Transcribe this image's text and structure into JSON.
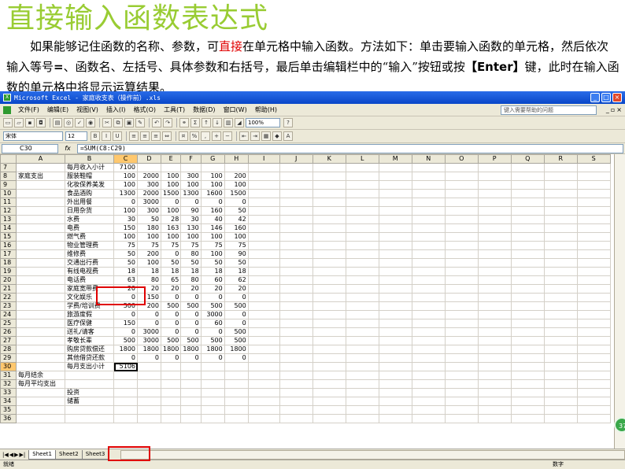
{
  "slide": {
    "title": "直接输入函数表达式",
    "intro_part1": "如果能够记住函数的名称、参数，可",
    "intro_highlight": "直接",
    "intro_part2": "在单元格中输入函数。方法如下：单击要输入函数的单元格，然后依次输入等号",
    "intro_equals": "=",
    "intro_part3": "、函数名、左括号、具体参数和右括号，最后单击编辑栏中的“输入”按钮或按",
    "intro_key": "【Enter】",
    "intro_part4": "键，此时在输入函数的单元格中将显示运算结果。",
    "page_badge": "37"
  },
  "excel": {
    "window_title": "Microsoft Excel - 家庭收支表（操作前）.xls",
    "menu": [
      "文件(F)",
      "编辑(E)",
      "视图(V)",
      "插入(I)",
      "格式(O)",
      "工具(T)",
      "数据(D)",
      "窗口(W)",
      "帮助(H)"
    ],
    "help_placeholder": "键入需要帮助的问题",
    "zoom": "100%",
    "font_name": "宋体",
    "font_size": "12",
    "name_box": "C30",
    "fx_label": "fx",
    "formula": "=SUM(C8:C29)",
    "columns": [
      "A",
      "B",
      "C",
      "D",
      "E",
      "F",
      "G",
      "H",
      "I",
      "J",
      "K",
      "L",
      "M",
      "N",
      "O",
      "P",
      "Q",
      "R",
      "S"
    ],
    "rows": [
      {
        "n": "7",
        "a": "",
        "b": "每月收入小计",
        "v": [
          "7100",
          "",
          "",
          "",
          "",
          ""
        ]
      },
      {
        "n": "8",
        "a": "家庭支出",
        "b": "服装鞋帽",
        "v": [
          "100",
          "2000",
          "100",
          "300",
          "100",
          "200"
        ]
      },
      {
        "n": "9",
        "a": "",
        "b": "化妆保养美发",
        "v": [
          "100",
          "300",
          "100",
          "100",
          "100",
          "100"
        ]
      },
      {
        "n": "10",
        "a": "",
        "b": "食品酒购",
        "v": [
          "1300",
          "2000",
          "1500",
          "1300",
          "1600",
          "1500"
        ]
      },
      {
        "n": "11",
        "a": "",
        "b": "外出用餐",
        "v": [
          "0",
          "3000",
          "0",
          "0",
          "0",
          "0"
        ]
      },
      {
        "n": "12",
        "a": "",
        "b": "日用杂货",
        "v": [
          "100",
          "300",
          "100",
          "90",
          "160",
          "50"
        ]
      },
      {
        "n": "13",
        "a": "",
        "b": "水费",
        "v": [
          "30",
          "50",
          "28",
          "30",
          "40",
          "42"
        ]
      },
      {
        "n": "14",
        "a": "",
        "b": "电费",
        "v": [
          "150",
          "180",
          "163",
          "130",
          "146",
          "160"
        ]
      },
      {
        "n": "15",
        "a": "",
        "b": "燃气费",
        "v": [
          "100",
          "100",
          "100",
          "100",
          "100",
          "100"
        ]
      },
      {
        "n": "16",
        "a": "",
        "b": "物业管理费",
        "v": [
          "75",
          "75",
          "75",
          "75",
          "75",
          "75"
        ]
      },
      {
        "n": "17",
        "a": "",
        "b": "维修费",
        "v": [
          "50",
          "200",
          "0",
          "80",
          "100",
          "90"
        ]
      },
      {
        "n": "18",
        "a": "",
        "b": "交通出行费",
        "v": [
          "50",
          "100",
          "50",
          "50",
          "50",
          "50"
        ]
      },
      {
        "n": "19",
        "a": "",
        "b": "有线电视费",
        "v": [
          "18",
          "18",
          "18",
          "18",
          "18",
          "18"
        ]
      },
      {
        "n": "20",
        "a": "",
        "b": "电话费",
        "v": [
          "63",
          "80",
          "65",
          "80",
          "60",
          "62"
        ]
      },
      {
        "n": "21",
        "a": "",
        "b": "家庭宽带费",
        "v": [
          "20",
          "20",
          "20",
          "20",
          "20",
          "20"
        ]
      },
      {
        "n": "22",
        "a": "",
        "b": "文化娱乐",
        "v": [
          "0",
          "150",
          "0",
          "0",
          "0",
          "0"
        ]
      },
      {
        "n": "23",
        "a": "",
        "b": "学费/培训费",
        "v": [
          "500",
          "200",
          "500",
          "500",
          "500",
          "500"
        ]
      },
      {
        "n": "24",
        "a": "",
        "b": "旅游度假",
        "v": [
          "0",
          "0",
          "0",
          "0",
          "3000",
          "0"
        ]
      },
      {
        "n": "25",
        "a": "",
        "b": "医疗保健",
        "v": [
          "150",
          "0",
          "0",
          "0",
          "60",
          "0"
        ]
      },
      {
        "n": "26",
        "a": "",
        "b": "送礼/请客",
        "v": [
          "0",
          "3000",
          "0",
          "0",
          "0",
          "500"
        ]
      },
      {
        "n": "27",
        "a": "",
        "b": "孝敬长辈",
        "v": [
          "500",
          "3000",
          "500",
          "500",
          "500",
          "500"
        ]
      },
      {
        "n": "28",
        "a": "",
        "b": "购房贷款偿还",
        "v": [
          "1800",
          "1800",
          "1800",
          "1800",
          "1800",
          "1800"
        ]
      },
      {
        "n": "29",
        "a": "",
        "b": "其他借贷还款",
        "v": [
          "0",
          "0",
          "0",
          "0",
          "0",
          "0"
        ]
      },
      {
        "n": "30",
        "a": "",
        "b": "每月支出小计",
        "v": [
          "5106",
          "",
          "",
          "",
          "",
          ""
        ]
      },
      {
        "n": "31",
        "a": "每月结余",
        "b": "",
        "v": [
          "",
          "",
          "",
          "",
          "",
          ""
        ]
      },
      {
        "n": "32",
        "a": "每月平均支出",
        "b": "",
        "v": [
          "",
          "",
          "",
          "",
          "",
          ""
        ]
      },
      {
        "n": "33",
        "a": "",
        "b": "投资",
        "v": [
          "",
          "",
          "",
          "",
          "",
          ""
        ]
      },
      {
        "n": "34",
        "a": "",
        "b": "储蓄",
        "v": [
          "",
          "",
          "",
          "",
          "",
          ""
        ]
      },
      {
        "n": "35",
        "a": "",
        "b": "",
        "v": [
          "",
          "",
          "",
          "",
          "",
          ""
        ]
      },
      {
        "n": "36",
        "a": "",
        "b": "",
        "v": [
          "",
          "",
          "",
          "",
          "",
          ""
        ]
      }
    ],
    "sheet_tabs": [
      "Sheet1",
      "Sheet2",
      "Sheet3"
    ],
    "status_left": "就绪",
    "status_mode": "数字"
  }
}
